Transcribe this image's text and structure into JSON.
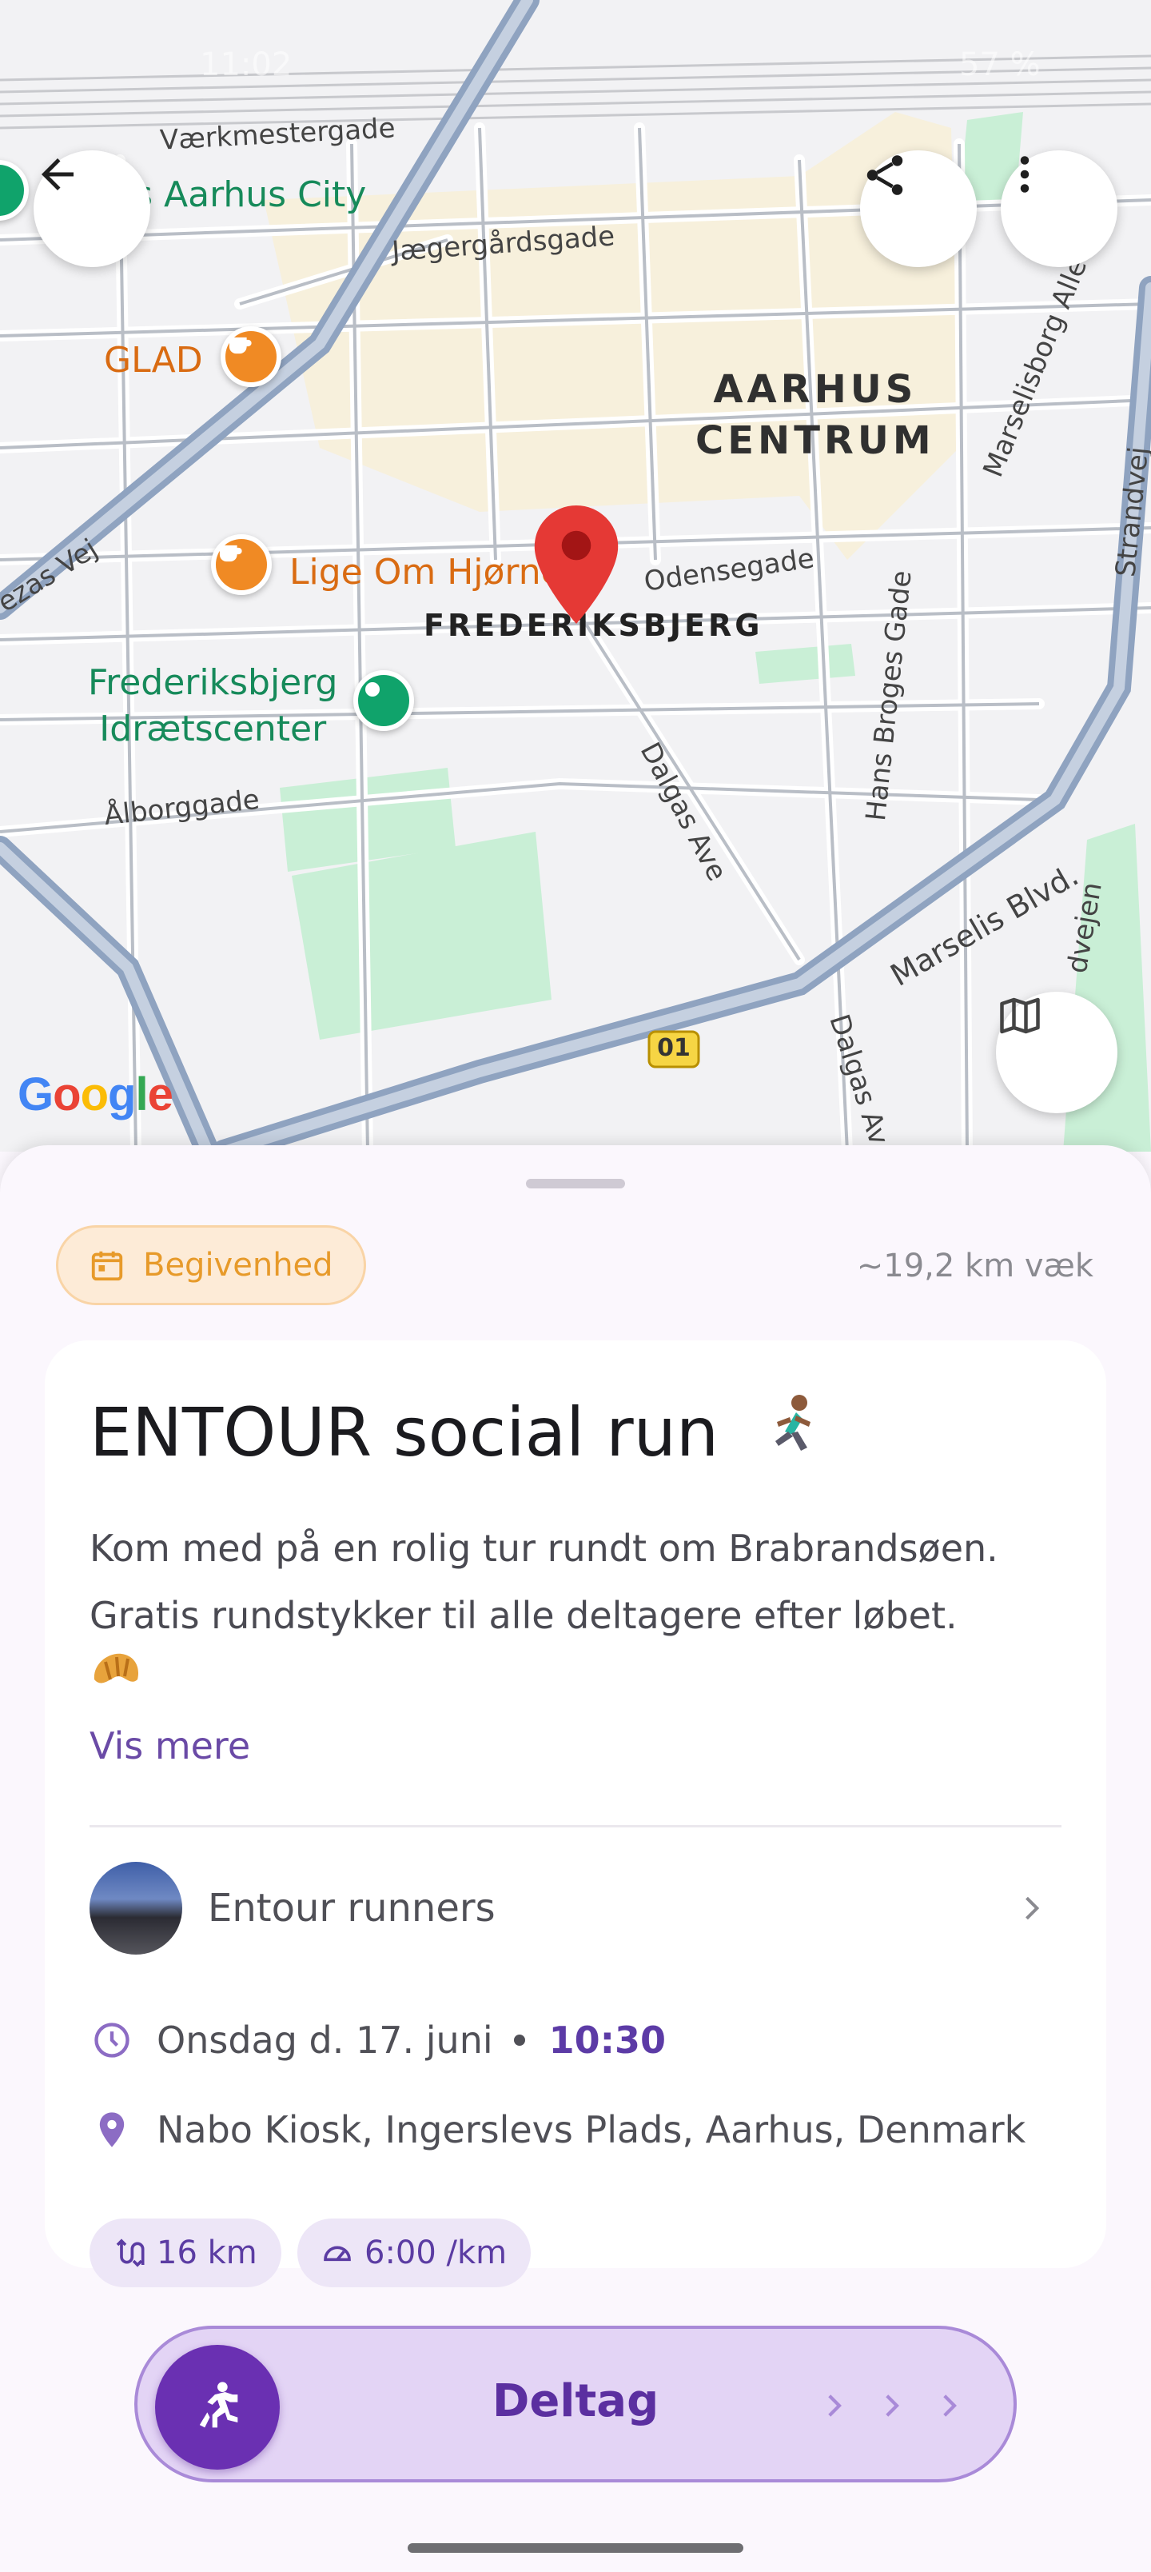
{
  "status_bar": {
    "time": "11:02",
    "battery": "57 %"
  },
  "map": {
    "streets": [
      "Værkmestergade",
      "Jægergårdsgade",
      "Odensegade",
      "Ålborggade",
      "Dalgas Ave",
      "Hans Broges Gade",
      "Marselis Blvd.",
      "Marselisborg Alle",
      "Dalgas Av",
      "ezas Vej",
      "dvejen",
      "Strandvej"
    ],
    "districts": {
      "centrum": "AARHUS\nCENTRUM",
      "frederiksbjerg": "FREDERIKSBJERG"
    },
    "pois": {
      "city": "rs Aarhus City",
      "glad": "GLAD",
      "lige": "Lige Om Hjørne",
      "idraet": "Frederiksbjerg\nIdrætscenter"
    },
    "road_badge": "01",
    "attribution": "Google"
  },
  "sheet": {
    "type_chip": "Begivenhed",
    "distance": "~19,2 km væk",
    "title": "ENTOUR social run",
    "description": "Kom med på en rolig tur rundt om Brabrandsøen. Gratis rundstykker til alle deltagere efter løbet.",
    "show_more": "Vis mere",
    "organizer": "Entour runners",
    "date": "Onsdag d. 17. juni",
    "time": "10:30",
    "location": "Nabo Kiosk, Ingerslevs Plads, Aarhus, Denmark",
    "distance_pill": "16 km",
    "pace_pill": "6:00 /km"
  },
  "join_button": {
    "label": "Deltag"
  },
  "colors": {
    "accent": "#6a30b2",
    "chip": "#e79a2a",
    "pin": "#e53935"
  }
}
